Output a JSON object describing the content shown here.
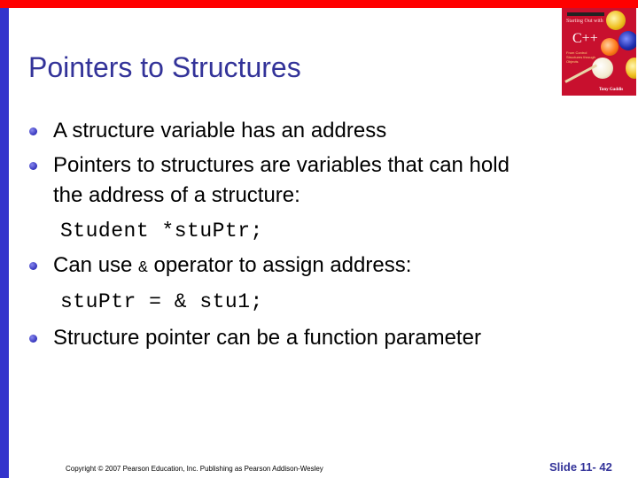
{
  "slide": {
    "title": "Pointers to Structures",
    "bullets": [
      {
        "text": "A structure variable has an address"
      },
      {
        "text_line1": "Pointers to structures are variables that can hold",
        "text_line2": "the address of a structure:",
        "code": "Student *stuPtr;"
      },
      {
        "text_before": "Can use ",
        "inline_code": "&",
        "text_after": " operator to assign address:",
        "code": "stuPtr = & stu1;"
      },
      {
        "text": "Structure pointer can be a function parameter"
      }
    ],
    "footer": {
      "copyright": "Copyright © 2007 Pearson Education, Inc. Publishing as Pearson Addison-Wesley",
      "slide_number": "Slide 11- 42"
    },
    "book_cover": {
      "title": "Starting Out with",
      "language": "C++",
      "subtitle": "From Control Structures through Objects",
      "author": "Tony Gaddis"
    },
    "colors": {
      "accent_red": "#ff0000",
      "accent_blue": "#3333cc",
      "title_color": "#333399"
    }
  }
}
